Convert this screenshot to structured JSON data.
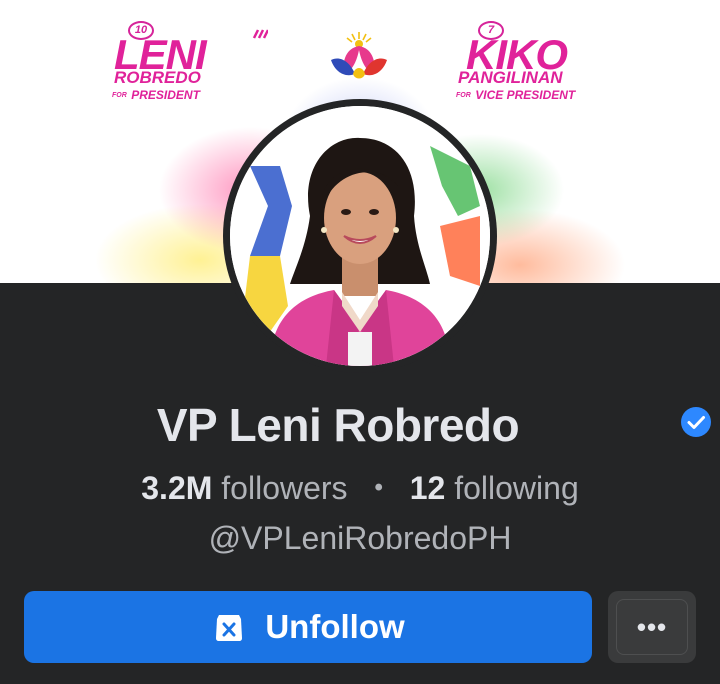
{
  "cover": {
    "left_logo": {
      "number": "10",
      "name": "LENI",
      "surname": "ROBREDO",
      "for_label": "FOR",
      "position": "PRESIDENT"
    },
    "right_logo": {
      "number": "7",
      "name": "KIKO",
      "surname": "PANGILINAN",
      "for_label": "FOR",
      "position": "VICE PRESIDENT"
    }
  },
  "profile": {
    "name": "VP Leni Robredo",
    "verified": true,
    "followers_count": "3.2M",
    "followers_label": "followers",
    "separator": "•",
    "following_count": "12",
    "following_label": "following",
    "handle": "@VPLeniRobredoPH"
  },
  "actions": {
    "unfollow_label": "Unfollow",
    "more_label": "•••"
  },
  "colors": {
    "background": "#242526",
    "primary_button": "#1b74e4",
    "secondary_button": "#3a3b3c",
    "verified_badge": "#2d88ff",
    "brand_pink": "#e0229a"
  },
  "icons": {
    "verified": "verified-badge-icon",
    "unfollow": "unfollow-icon",
    "more": "more-dots-icon"
  }
}
